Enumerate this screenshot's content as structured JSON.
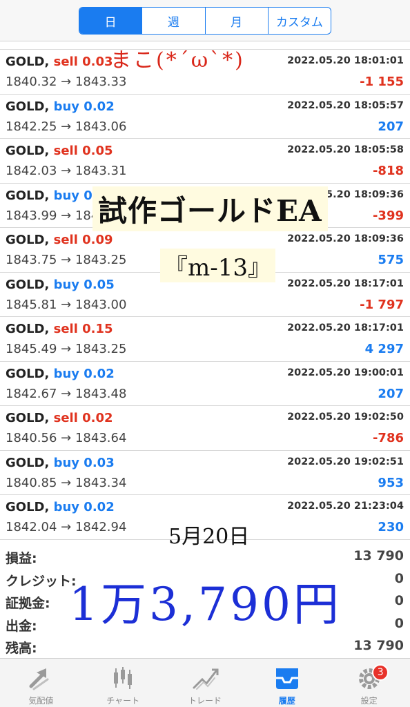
{
  "tabs": [
    {
      "label": "日",
      "active": true
    },
    {
      "label": "週",
      "active": false
    },
    {
      "label": "月",
      "active": false
    },
    {
      "label": "カスタム",
      "active": false
    }
  ],
  "trades": [
    {
      "symbol": "GOLD,",
      "side": "sell",
      "side_label": "sell 0.03",
      "time": "2022.05.20 18:01:01",
      "prices": "1840.32 → 1843.33",
      "profit": "-1 155"
    },
    {
      "symbol": "GOLD,",
      "side": "buy",
      "side_label": "buy 0.02",
      "time": "2022.05.20 18:05:57",
      "prices": "1842.25 → 1843.06",
      "profit": "207"
    },
    {
      "symbol": "GOLD,",
      "side": "sell",
      "side_label": "sell 0.05",
      "time": "2022.05.20 18:05:58",
      "prices": "1842.03 → 1843.31",
      "profit": "-818"
    },
    {
      "symbol": "GOLD,",
      "side": "buy",
      "side_label": "buy 0.03",
      "time": "2022.05.20 18:09:36",
      "prices": "1843.99 → 1843.",
      "profit": "-399"
    },
    {
      "symbol": "GOLD,",
      "side": "sell",
      "side_label": "sell 0.09",
      "time": "2022.05.20 18:09:36",
      "prices": "1843.75 → 1843.25",
      "profit": "575"
    },
    {
      "symbol": "GOLD,",
      "side": "buy",
      "side_label": "buy 0.05",
      "time": "2022.05.20 18:17:01",
      "prices": "1845.81 → 1843.00",
      "profit": "-1 797"
    },
    {
      "symbol": "GOLD,",
      "side": "sell",
      "side_label": "sell 0.15",
      "time": "2022.05.20 18:17:01",
      "prices": "1845.49 → 1843.25",
      "profit": "4 297"
    },
    {
      "symbol": "GOLD,",
      "side": "buy",
      "side_label": "buy 0.02",
      "time": "2022.05.20 19:00:01",
      "prices": "1842.67 → 1843.48",
      "profit": "207"
    },
    {
      "symbol": "GOLD,",
      "side": "sell",
      "side_label": "sell 0.02",
      "time": "2022.05.20 19:02:50",
      "prices": "1840.56 → 1843.64",
      "profit": "-786"
    },
    {
      "symbol": "GOLD,",
      "side": "buy",
      "side_label": "buy 0.03",
      "time": "2022.05.20 19:02:51",
      "prices": "1840.85 → 1843.34",
      "profit": "953"
    },
    {
      "symbol": "GOLD,",
      "side": "buy",
      "side_label": "buy 0.02",
      "time": "2022.05.20 21:23:04",
      "prices": "1842.04 → 1842.94",
      "profit": "230"
    }
  ],
  "summary": [
    {
      "label": "損益:",
      "value": "13 790"
    },
    {
      "label": "クレジット:",
      "value": "0"
    },
    {
      "label": "証拠金:",
      "value": "0"
    },
    {
      "label": "出金:",
      "value": "0"
    },
    {
      "label": "残高:",
      "value": "13 790"
    }
  ],
  "handwriting": {
    "signature": "まこ(*´ω`*)",
    "title": "試作ゴールドEA",
    "code": "『m-13』",
    "date": "5月20日",
    "amount": "1万3,790円"
  },
  "tabbar": [
    {
      "label": "気配値",
      "icon": "quotes-icon",
      "active": false
    },
    {
      "label": "チャート",
      "icon": "chart-icon",
      "active": false
    },
    {
      "label": "トレード",
      "icon": "trade-icon",
      "active": false
    },
    {
      "label": "履歴",
      "icon": "history-icon",
      "active": true
    },
    {
      "label": "設定",
      "icon": "settings-icon",
      "active": false,
      "badge": "3"
    }
  ],
  "colors": {
    "accent": "#1a7cf0",
    "sell": "#e0321e",
    "buy": "#1a7cf0"
  }
}
